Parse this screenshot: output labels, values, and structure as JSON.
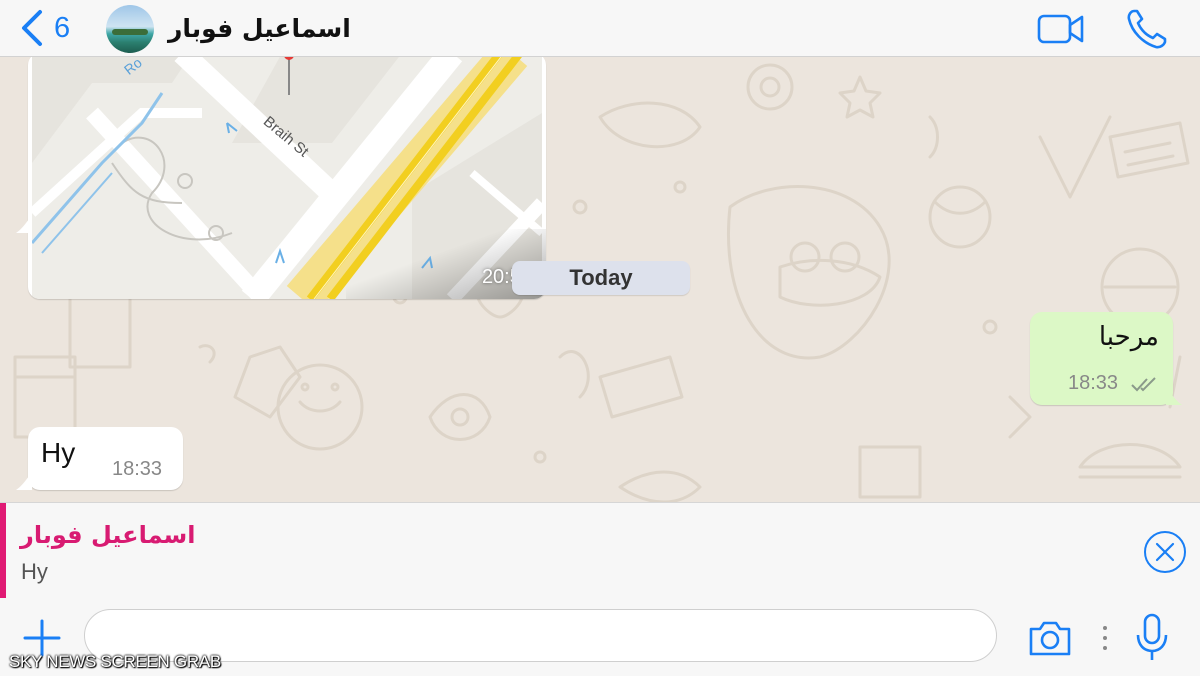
{
  "header": {
    "back_count": "6",
    "contact_name": "اسماعيل فوبار"
  },
  "messages": {
    "map": {
      "street_label_1": "Braih St",
      "street_label_2": "Ro",
      "time": "20:54"
    },
    "date_divider": "Today",
    "outgoing": {
      "text": "مرحبا",
      "time": "18:33",
      "status": "read"
    },
    "incoming": {
      "text": "Hy",
      "time": "18:33"
    }
  },
  "reply": {
    "name": "اسماعيل فوبار",
    "text": "Hy"
  },
  "input": {
    "value": "",
    "placeholder": ""
  },
  "watermark": "SKY NEWS SCREEN GRAB",
  "colors": {
    "accent": "#1a7ff5",
    "reply_name": "#d81b72",
    "outgoing_bubble": "#dcf8c6",
    "chat_background": "#ece5dd"
  },
  "icons": [
    "chevron-left-icon",
    "video-call-icon",
    "phone-icon",
    "close-circle-icon",
    "plus-icon",
    "camera-icon",
    "more-vertical-icon",
    "microphone-icon",
    "double-check-icon"
  ]
}
